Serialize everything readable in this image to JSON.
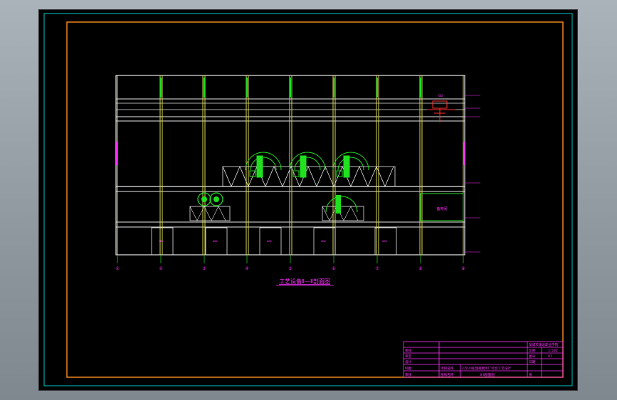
{
  "drawing": {
    "section_title": "工艺设备Ⅱ—Ⅱ剖面图",
    "room_label": "备用间",
    "axis_numbers": [
      "①",
      "②",
      "③",
      "④",
      "⑤",
      "⑥",
      "⑦",
      "⑧",
      "⑨"
    ]
  },
  "title_block": {
    "project_name_label": "项目名称",
    "project_name_value": "2万t/d处理规模水厂综合工艺设计",
    "drawing_name_label": "图纸名称",
    "drawing_name_value": "Ⅱ-Ⅱ剖面图",
    "designer_label": "设计",
    "drafter_label": "制图",
    "checker_label": "审核",
    "approver_label": "审定",
    "school": "某城市建设职业学院",
    "scale_label": "比例",
    "scale_value": "1:100",
    "sheet_no_label": "图号",
    "sheet_no_value": "07",
    "date_label": "日期",
    "review_label": "审核",
    "sheet_label": "张"
  },
  "colors": {
    "outer_border": "#00c8c8",
    "inner_border": "#ff9020",
    "structure": "#e8e8e8",
    "columns": "#d8d850",
    "equipment": "#20e020",
    "annotation": "#ff30ff",
    "title_block": "#ff30ff"
  }
}
